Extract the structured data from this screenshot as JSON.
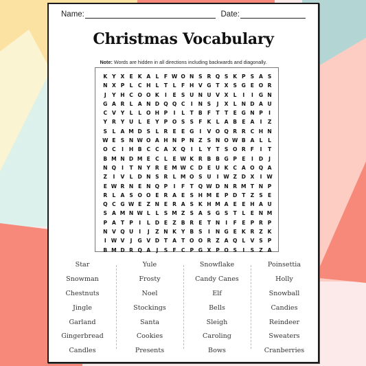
{
  "background": {
    "colors": {
      "yellow": "#fbe2a2",
      "cream": "#fbf4d2",
      "mint": "#dcf1eb",
      "coral": "#f6897a",
      "teal": "#b3d6d4",
      "peach": "#fdcdc3",
      "blush": "#fce9ea"
    }
  },
  "worksheet": {
    "name_label": "Name:",
    "date_label": "Date:",
    "title": "Christmas Vocabulary",
    "note_label": "Note:",
    "note_text": " Words are hidden in all directions including backwards and diagonally."
  },
  "grid": {
    "rows": [
      "KYXEKALFWONSRQSKPSAS",
      "NXPLCHLTLFHVGTXSGEOR",
      "JYHCOOKIESUNUVXLIIGN",
      "GARLANDQQCINSJXLNDAU",
      "CVYLLOHPILTBFTTEGNPI",
      "YRYULEYPOSSFKLABEAIZ",
      "SLAMDSLREEGIVOQRRCHN",
      "WESNWOAHNPNZSNOWBALL",
      "OCIHBCCAXQILYTSORFIT",
      "BMNDMECLEWKRBBGPEIDJ",
      "NQITNYREMWCDEUKCAOQA",
      "ZIVLDNSRLMOSUIWZDXIW",
      "EWRNENQPIFTQWDNRMTNP",
      "RLASOOERAESHMEPDTZSE",
      "QCGWEZNERASKHMAEEHAU",
      "SAMNWLLSMZSASGSTLENM",
      "PATPILDEZBRETNIFEPRP",
      "NVQUIJZNKYBSINGEKRZK",
      "IWVJGVDTATOORZAQLVSP",
      "BMDRQAJSFCPGXPOSISZA"
    ]
  },
  "word_list": {
    "columns": [
      [
        "Star",
        "Snowman",
        "Chestnuts",
        "Jingle",
        "Garland",
        "Gingerbread",
        "Candles"
      ],
      [
        "Yule",
        "Frosty",
        "Noel",
        "Stockings",
        "Santa",
        "Cookies",
        "Presents"
      ],
      [
        "Snowflake",
        "Candy Canes",
        "Elf",
        "Bells",
        "Sleigh",
        "Caroling",
        "Bows"
      ],
      [
        "Poinsettia",
        "Holly",
        "Snowball",
        "Candies",
        "Reindeer",
        "Sweaters",
        "Cranberries"
      ]
    ]
  }
}
